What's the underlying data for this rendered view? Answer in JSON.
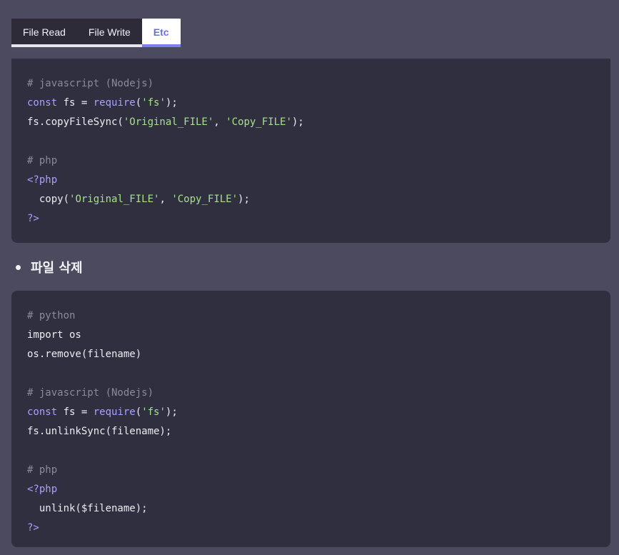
{
  "tabs": [
    {
      "label": "File Read"
    },
    {
      "label": "File Write"
    },
    {
      "label": "Etc"
    }
  ],
  "code_block_1": {
    "lines": [
      {
        "comment": "# javascript (Nodejs)"
      },
      {
        "kw1": "const",
        "mid1": " fs = ",
        "kw2": "require",
        "p1": "(",
        "str1": "'fs'",
        "p2": ");"
      },
      {
        "pre": "fs.copyFileSync(",
        "str1": "'Original_FILE'",
        "mid": ", ",
        "str2": "'Copy_FILE'",
        "post": ");"
      },
      {
        "comment": "# php"
      },
      {
        "tag": "<?php"
      },
      {
        "pre": "  copy(",
        "str1": "'Original_FILE'",
        "mid": ", ",
        "str2": "'Copy_FILE'",
        "post": ");"
      },
      {
        "tag": "?>"
      }
    ]
  },
  "section": {
    "title": "파일 삭제"
  },
  "code_block_2": {
    "lines": [
      {
        "comment": "# python"
      },
      {
        "text": "import os"
      },
      {
        "text": "os.remove(filename)"
      },
      {
        "comment": "# javascript (Nodejs)"
      },
      {
        "kw1": "const",
        "mid1": " fs = ",
        "kw2": "require",
        "p1": "(",
        "str1": "'fs'",
        "p2": ");"
      },
      {
        "text": "fs.unlinkSync(filename);"
      },
      {
        "comment": "# php"
      },
      {
        "tag": "<?php"
      },
      {
        "text": "  unlink($filename);"
      },
      {
        "tag": "?>"
      }
    ]
  },
  "colors": {
    "background": "#4b4a5f",
    "code_bg": "#302f3f",
    "accent": "#7b7ff0",
    "comment": "#8b8a99",
    "keyword": "#a7a1ff",
    "string": "#a7e08a"
  }
}
